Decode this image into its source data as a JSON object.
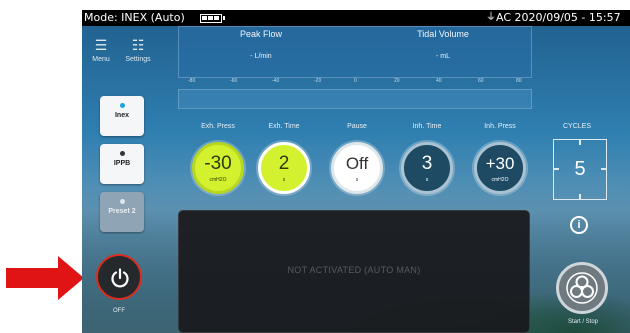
{
  "statusbar": {
    "mode": "Mode: INEX (Auto)",
    "power_source": "AC",
    "datetime": "2020/09/05 - 15:57"
  },
  "nav": {
    "menu_label": "Menu",
    "settings_label": "Settings"
  },
  "modes": {
    "inex_label": "Inex",
    "ippb_label": "IPPB",
    "preset_label": "Preset 2"
  },
  "readouts": {
    "peak_flow_title": "Peak Flow",
    "peak_flow_value": "- L/min",
    "tidal_volume_title": "Tidal Volume",
    "tidal_volume_value": "- mL"
  },
  "scale": {
    "ticks": [
      "-80",
      "-60",
      "-40",
      "-20",
      "0",
      "20",
      "40",
      "60",
      "80"
    ]
  },
  "params": {
    "exh_press": {
      "label": "Exh. Press",
      "value": "-30",
      "unit": "cmH2O"
    },
    "exh_time": {
      "label": "Exh. Time",
      "value": "2",
      "unit": "s"
    },
    "pause": {
      "label": "Pause",
      "value": "Off",
      "unit": "s"
    },
    "inh_time": {
      "label": "Inh. Time",
      "value": "3",
      "unit": "s"
    },
    "inh_press": {
      "label": "Inh. Press",
      "value": "+30",
      "unit": "cmH2O"
    }
  },
  "cycles": {
    "label": "CYCLES",
    "value": "5"
  },
  "graph": {
    "message": "NOT ACTIVATED (AUTO MAN)"
  },
  "power": {
    "label": "OFF"
  },
  "start": {
    "label": "Start / Stop"
  },
  "colors": {
    "accent_green": "#d4f130",
    "power_ring": "#d92d20",
    "annotation_arrow": "#e01414",
    "panel_blue": "#2f7fb0"
  },
  "icons": [
    "menu-icon",
    "settings-icon",
    "power-icon",
    "info-icon",
    "fan-icon",
    "battery-icon",
    "plug-icon"
  ]
}
